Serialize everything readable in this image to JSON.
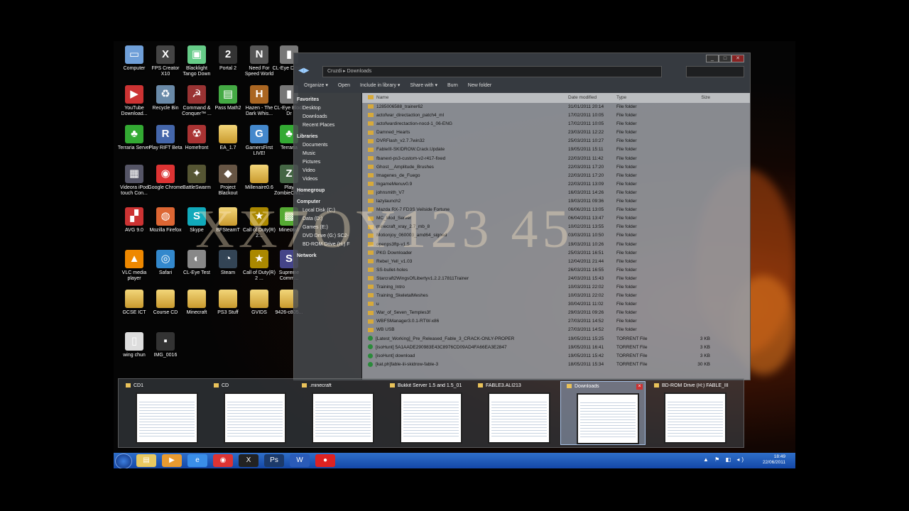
{
  "desktop_icons": [
    {
      "label": "Computer",
      "glyph": "▭",
      "color": "#6f9fd8"
    },
    {
      "label": "FPS Creator X10",
      "glyph": "X",
      "color": "#444"
    },
    {
      "label": "Blacklight Tango Down",
      "glyph": "▣",
      "color": "#6c8"
    },
    {
      "label": "Portal 2",
      "glyph": "2",
      "color": "#333"
    },
    {
      "label": "Need For Speed World",
      "glyph": "N",
      "color": "#555"
    },
    {
      "label": "CL-Eye Device",
      "glyph": "▮",
      "color": "#777"
    },
    {
      "label": "YouTube Download...",
      "glyph": "▶",
      "color": "#c33"
    },
    {
      "label": "Recycle Bin",
      "glyph": "♻",
      "color": "#6a8aa8"
    },
    {
      "label": "Command & Conquer™ ...",
      "glyph": "☭",
      "color": "#933"
    },
    {
      "label": "Pass Math2",
      "glyph": "▤",
      "color": "#4a4"
    },
    {
      "label": "Hazen - The Dark Whis...",
      "glyph": "H",
      "color": "#a62"
    },
    {
      "label": "CL-Eye Block Dr",
      "glyph": "▮",
      "color": "#777"
    },
    {
      "label": "Terraria Server",
      "glyph": "♣",
      "color": "#3a3"
    },
    {
      "label": "Play RIFT Beta",
      "glyph": "R",
      "color": "#46a"
    },
    {
      "label": "Homefront",
      "glyph": "☢",
      "color": "#a33"
    },
    {
      "label": "EA_1.7",
      "glyph": "",
      "color": "folder"
    },
    {
      "label": "GamersFirst LIVE!",
      "glyph": "G",
      "color": "#48c"
    },
    {
      "label": "Terraria",
      "glyph": "♣",
      "color": "#3a3"
    },
    {
      "label": "Videora iPod touch Con...",
      "glyph": "▦",
      "color": "#556"
    },
    {
      "label": "Google Chrome",
      "glyph": "◉",
      "color": "#d33"
    },
    {
      "label": "BattleSwarm",
      "glyph": "✦",
      "color": "#553"
    },
    {
      "label": "Project Blackout",
      "glyph": "◆",
      "color": "#654"
    },
    {
      "label": "Millenaire0.6",
      "glyph": "",
      "color": "folder"
    },
    {
      "label": "Play ZombieChri...",
      "glyph": "Z",
      "color": "#464"
    },
    {
      "label": "AVG 9.0",
      "glyph": "▞",
      "color": "#c33"
    },
    {
      "label": "Mozilla Firefox",
      "glyph": "◍",
      "color": "#d63"
    },
    {
      "label": "Skype",
      "glyph": "S",
      "color": "#1ab"
    },
    {
      "label": "BFSteamT",
      "glyph": "",
      "color": "folder"
    },
    {
      "label": "Call of Duty(R) 2...",
      "glyph": "★",
      "color": "#a80"
    },
    {
      "label": "Minecraft",
      "glyph": "▩",
      "color": "#5a3"
    },
    {
      "label": "VLC media player",
      "glyph": "▲",
      "color": "#e80"
    },
    {
      "label": "Safari",
      "glyph": "◎",
      "color": "#38c"
    },
    {
      "label": "CL-Eye Test",
      "glyph": "◐",
      "color": "#888"
    },
    {
      "label": "Steam",
      "glyph": "◔",
      "color": "#345"
    },
    {
      "label": "Call of Duty(R) 2 ...",
      "glyph": "★",
      "color": "#a80"
    },
    {
      "label": "Supreme Comm...",
      "glyph": "S",
      "color": "#448"
    },
    {
      "label": "GCSE ICT",
      "glyph": "",
      "color": "folder"
    },
    {
      "label": "Course CD",
      "glyph": "",
      "color": "folder"
    },
    {
      "label": "Minecraft",
      "glyph": "",
      "color": "folder"
    },
    {
      "label": "PS3 Stuff",
      "glyph": "",
      "color": "folder"
    },
    {
      "label": "GVIDS",
      "glyph": "",
      "color": "folder"
    },
    {
      "label": "9426-c805...",
      "glyph": "",
      "color": "folder"
    },
    {
      "label": "wing chun",
      "glyph": "▯",
      "color": "#ddd"
    },
    {
      "label": "IMG_0016",
      "glyph": "▪",
      "color": "#333"
    }
  ],
  "watermark": "XX7OY123 45",
  "explorer": {
    "address": "Cruzdi  ▸  Downloads",
    "toolbar": [
      "Organize ▾",
      "Open",
      "Include in library ▾",
      "Share with ▾",
      "Burn",
      "New folder"
    ],
    "nav": {
      "favorites_title": "Favorites",
      "favorites": [
        "Desktop",
        "Downloads",
        "Recent Places"
      ],
      "libraries_title": "Libraries",
      "libraries": [
        "Documents",
        "Music",
        "Pictures",
        "Video",
        "Videos"
      ],
      "homegroup": "Homegroup",
      "computer_title": "Computer",
      "drives": [
        "Local Disk (C:)",
        "Data (D:)",
        "Games (E:)",
        "DVD Drive (G:) SC2-",
        "BD-ROM Drive (H:) F"
      ],
      "network": "Network"
    },
    "columns": [
      "Name",
      "Date modified",
      "Type",
      "Size"
    ],
    "files": [
      {
        "name": "1285006588_trainer62",
        "date": "31/01/2011 20:14",
        "type": "File folder",
        "size": ""
      },
      {
        "name": "actofwar_directaction_patch4_ml",
        "date": "17/02/2011 10:05",
        "type": "File folder",
        "size": ""
      },
      {
        "name": "actofwardirectaction-nocd-1_06-ENG",
        "date": "17/02/2011 10:05",
        "type": "File folder",
        "size": ""
      },
      {
        "name": "Damned_Hearts",
        "date": "23/03/2011 12:22",
        "type": "File folder",
        "size": ""
      },
      {
        "name": "DVRFlash_v2.7.7win32",
        "date": "25/03/2011 10:27",
        "type": "File folder",
        "size": ""
      },
      {
        "name": "FableIII-SKIDROW.Crack.Update",
        "date": "19/05/2011 15:11",
        "type": "File folder",
        "size": ""
      },
      {
        "name": "fbanext-ps3-custom-v2-r417-fixed",
        "date": "22/03/2011 11:42",
        "type": "File folder",
        "size": ""
      },
      {
        "name": "Ghost__Amplitude_Brushes",
        "date": "22/03/2011 17:20",
        "type": "File folder",
        "size": ""
      },
      {
        "name": "Imagenes_de_Fuego",
        "date": "22/03/2011 17:20",
        "type": "File folder",
        "size": ""
      },
      {
        "name": "IngameMenuv0.9",
        "date": "22/03/2011 13:09",
        "type": "File folder",
        "size": ""
      },
      {
        "name": "johnsmith_V7",
        "date": "16/03/2011 14:26",
        "type": "File folder",
        "size": ""
      },
      {
        "name": "lazylaunch2",
        "date": "19/03/2011 09:36",
        "type": "File folder",
        "size": ""
      },
      {
        "name": "Mazda RX-7 FD3S Veilside Fortune",
        "date": "06/06/2011 13:05",
        "type": "File folder",
        "size": ""
      },
      {
        "name": "MC_Mod_Server",
        "date": "06/04/2011 13:47",
        "type": "File folder",
        "size": ""
      },
      {
        "name": "minecraft_xray_2.7_mb_8",
        "date": "10/02/2011 13:55",
        "type": "File folder",
        "size": ""
      },
      {
        "name": "Motionjoy_060003_amd64_signed",
        "date": "03/03/2011 10:50",
        "type": "File folder",
        "size": ""
      },
      {
        "name": "openps3ftp-v1.5",
        "date": "19/03/2011 10:26",
        "type": "File folder",
        "size": ""
      },
      {
        "name": "PKG Downloader",
        "date": "25/03/2011 16:51",
        "type": "File folder",
        "size": ""
      },
      {
        "name": "Rebel_Yell_v1.03",
        "date": "12/04/2011 21:44",
        "type": "File folder",
        "size": ""
      },
      {
        "name": "SS-bullet-holes",
        "date": "26/03/2011 16:55",
        "type": "File folder",
        "size": ""
      },
      {
        "name": "Starcraft2WingsOfLibertyv1.2.2.17811Trainer",
        "date": "24/03/2011 15:43",
        "type": "File folder",
        "size": ""
      },
      {
        "name": "Training_Intro",
        "date": "10/03/2011 22:02",
        "type": "File folder",
        "size": ""
      },
      {
        "name": "Training_SkeletalMeshes",
        "date": "10/03/2011 22:02",
        "type": "File folder",
        "size": ""
      },
      {
        "name": "u",
        "date": "30/04/2011 11:02",
        "type": "File folder",
        "size": ""
      },
      {
        "name": "War_of_Seven_Temples3f",
        "date": "29/03/2011 09:26",
        "type": "File folder",
        "size": ""
      },
      {
        "name": "WBFSManager3.0.1-RTW-x86",
        "date": "27/03/2011 14:52",
        "type": "File folder",
        "size": ""
      },
      {
        "name": "WB USB",
        "date": "27/03/2011 14:52",
        "type": "File folder",
        "size": ""
      },
      {
        "name": "[Latest_Working]_Pre_Released_Fable_3_CRACK-ONLY-PROPER",
        "date": "19/05/2011 15:25",
        "type": "TORRENT File",
        "size": "3 KB",
        "torrent": true
      },
      {
        "name": "[isoHunt] 5A1AADE290983E43C8976CD09AD4FA66EA3E2847",
        "date": "19/05/2011 16:41",
        "type": "TORRENT File",
        "size": "3 KB",
        "torrent": true
      },
      {
        "name": "[isoHunt] download",
        "date": "19/05/2011 15:42",
        "type": "TORRENT File",
        "size": "3 KB",
        "torrent": true
      },
      {
        "name": "[kat.ph]fable-iii-skidrow-fable-3",
        "date": "18/05/2011 15:34",
        "type": "TORRENT File",
        "size": "30 KB",
        "torrent": true
      }
    ]
  },
  "switcher": [
    {
      "title": "CD1",
      "active": false
    },
    {
      "title": "CD",
      "active": false
    },
    {
      "title": ".minecraft",
      "active": false
    },
    {
      "title": "Bukkit Server 1.5 and 1.5_01",
      "active": false
    },
    {
      "title": "FABLE3.ALI213",
      "active": false
    },
    {
      "title": "Downloads",
      "active": true
    },
    {
      "title": "BD-ROM Drive (H:) FABLE_III",
      "active": false
    }
  ],
  "taskbar": {
    "apps": [
      {
        "name": "explorer",
        "glyph": "▤",
        "color": "#e8c860"
      },
      {
        "name": "media-player",
        "glyph": "▶",
        "color": "#e89a30"
      },
      {
        "name": "internet-explorer",
        "glyph": "e",
        "color": "#3a8ee8"
      },
      {
        "name": "chrome",
        "glyph": "◉",
        "color": "#d33"
      },
      {
        "name": "x10",
        "glyph": "X",
        "color": "#222"
      },
      {
        "name": "photoshop",
        "glyph": "Ps",
        "color": "#1c3a6a"
      },
      {
        "name": "word",
        "glyph": "W",
        "color": "#2a5bb8"
      },
      {
        "name": "red-app",
        "glyph": "●",
        "color": "#d22"
      }
    ],
    "tray_icons": "▲ ⚑ ◧ ◂)",
    "time": "18:49",
    "date": "22/06/2011"
  }
}
